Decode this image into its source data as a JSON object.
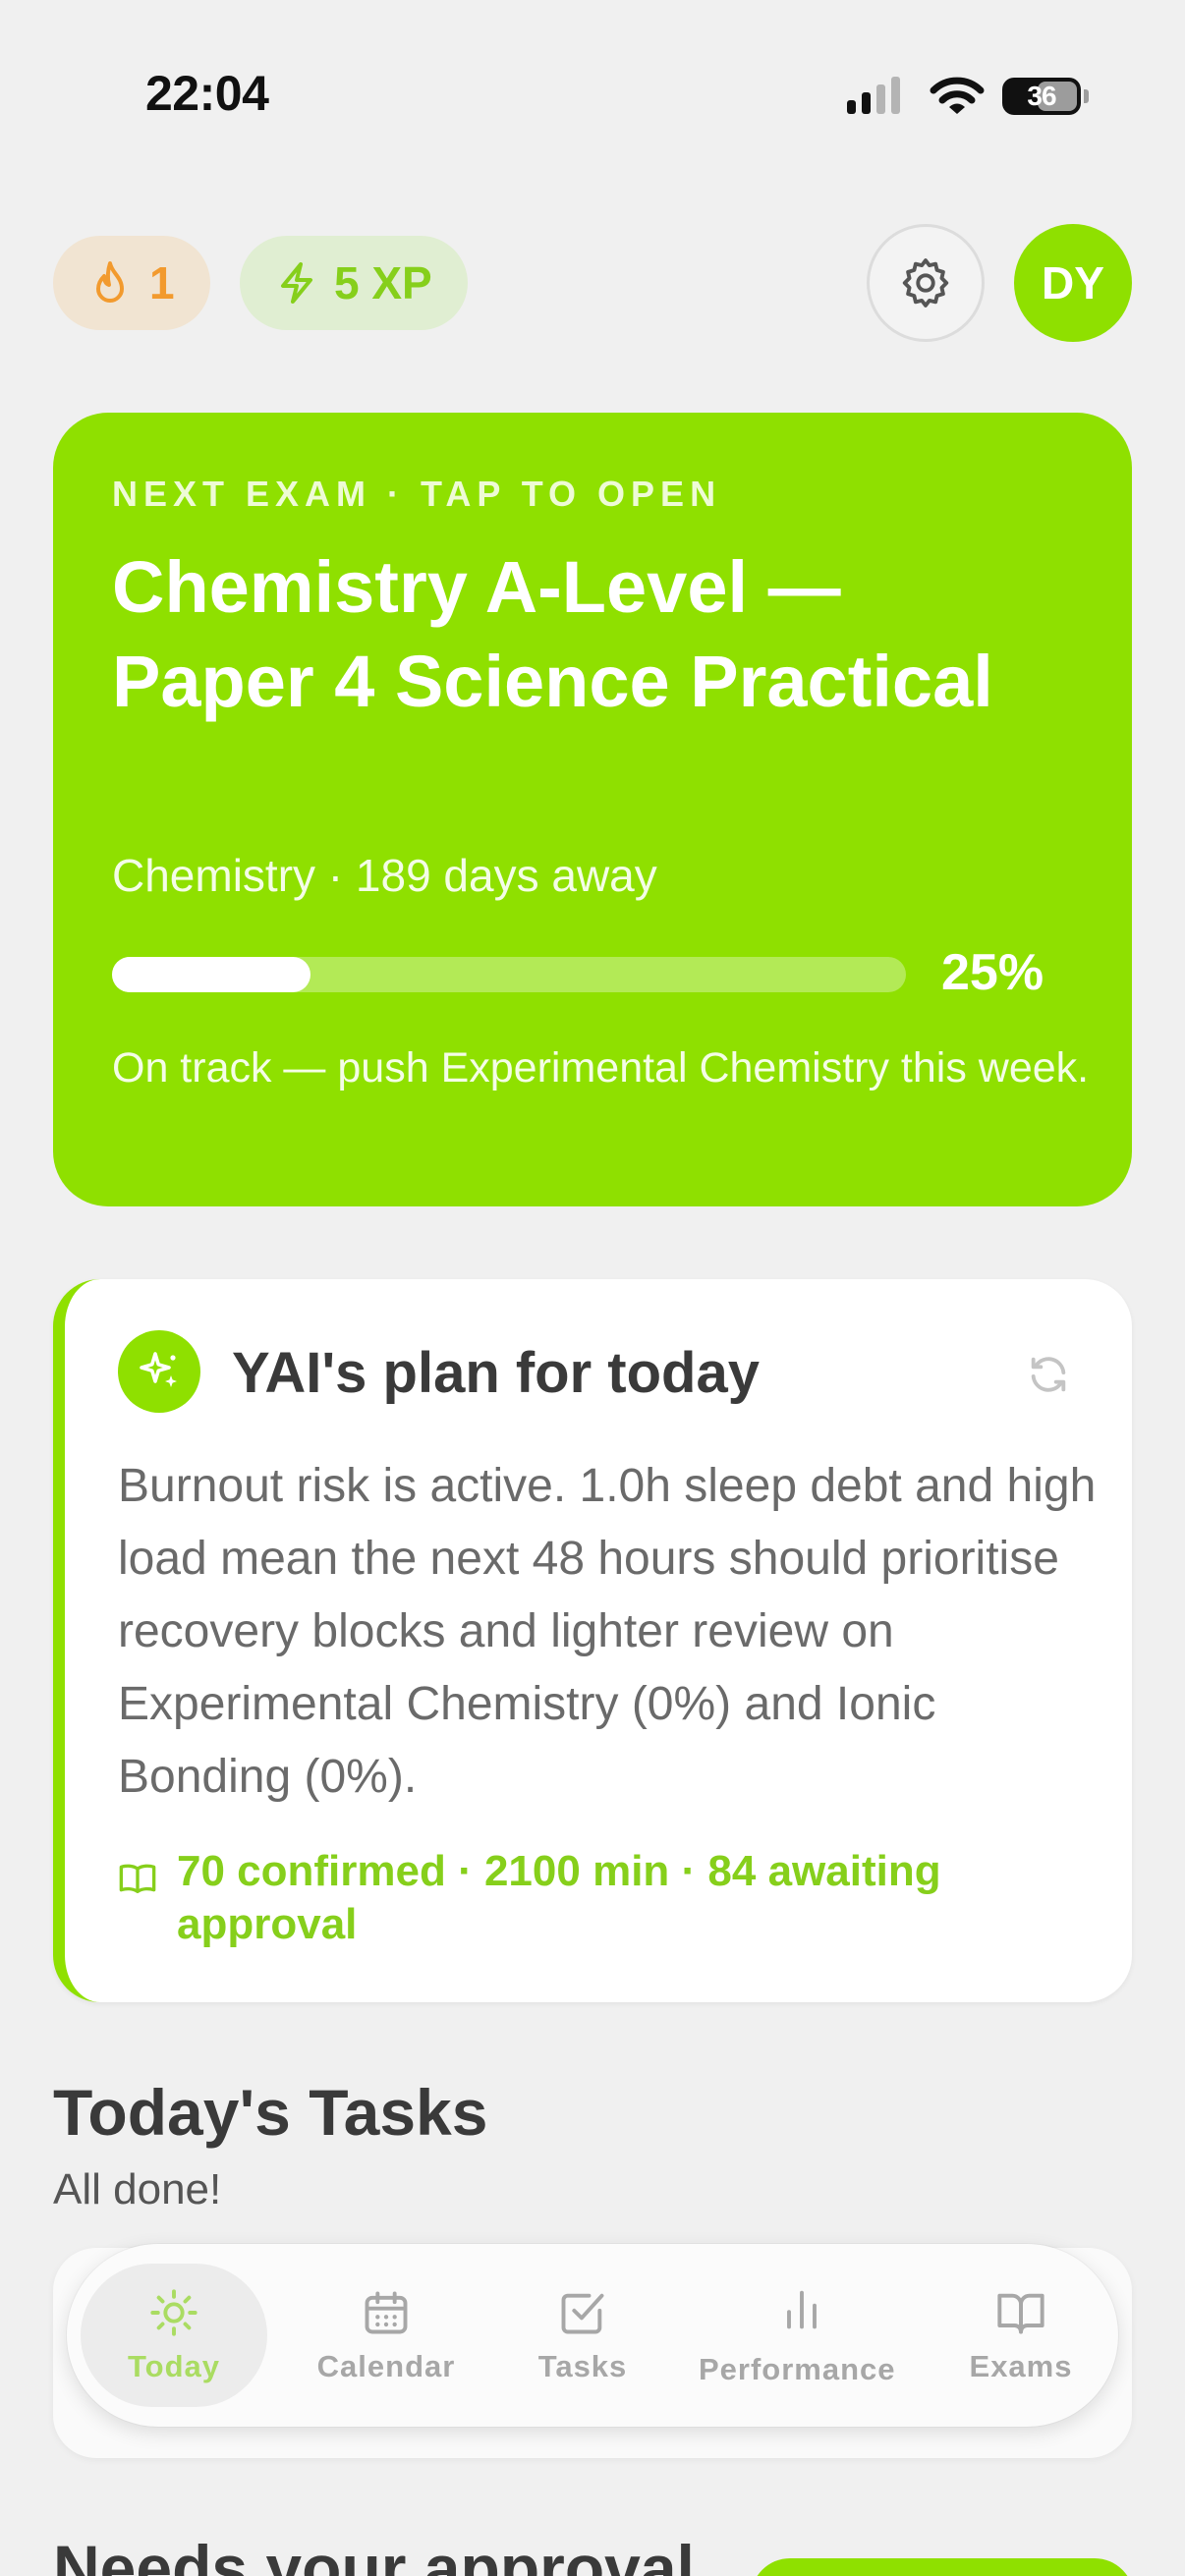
{
  "status_bar": {
    "time": "22:04",
    "battery": "36",
    "icons": [
      "signal-icon",
      "wifi-icon",
      "battery-icon"
    ]
  },
  "header": {
    "streak": {
      "icon": "flame-icon",
      "value": "1"
    },
    "xp": {
      "icon": "bolt-icon",
      "value": "5 XP"
    },
    "settings_icon": "gear-icon",
    "avatar_initials": "DY"
  },
  "next_exam": {
    "eyebrow": "NEXT EXAM · TAP TO OPEN",
    "title": "Chemistry A-Level — Paper 4 Science Practical",
    "subtitle": "Chemistry · 189 days away",
    "progress": 0.25,
    "progress_label": "25%",
    "note": "On track — push Experimental Chemistry this week."
  },
  "plan": {
    "icon": "sparkle-icon",
    "title": "YAI's plan for today",
    "refresh_icon": "refresh-icon",
    "body": "Burnout risk is active. 1.0h sleep debt and high load mean the next 48 hours should prioritise recovery blocks and lighter review on Experimental Chemistry (0%) and Ionic Bonding (0%).",
    "meta_icon": "book-icon",
    "meta": "70 confirmed · 2100 min · 84 awaiting approval"
  },
  "tasks": {
    "heading": "Today's Tasks",
    "subtitle": "All done!"
  },
  "approval": {
    "heading": "Needs your approval"
  },
  "nav": {
    "items": [
      {
        "label": "Today",
        "icon": "sun-icon",
        "active": true
      },
      {
        "label": "Calendar",
        "icon": "calendar-icon",
        "active": false
      },
      {
        "label": "Tasks",
        "icon": "checkbox-icon",
        "active": false
      },
      {
        "label": "Performance",
        "icon": "bar-chart-icon",
        "active": false
      },
      {
        "label": "Exams",
        "icon": "open-book-icon",
        "active": false
      }
    ]
  },
  "colors": {
    "accent": "#8fe000",
    "background": "#f0f0f0",
    "streak_bg": "#f1e4d2",
    "streak_fg": "#f29a2e",
    "xp_bg": "#e0eed2",
    "xp_fg": "#86cf1b"
  }
}
